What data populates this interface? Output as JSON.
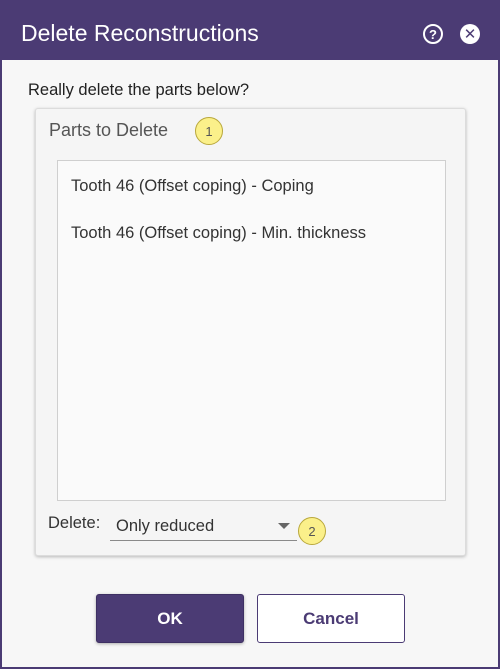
{
  "window": {
    "title": "Delete Reconstructions",
    "help_glyph": "?",
    "close_glyph": "✕"
  },
  "prompt": "Really delete the parts below?",
  "group": {
    "title": "Parts to Delete",
    "badge": "1",
    "items": [
      "Tooth 46 (Offset coping) - Coping",
      "Tooth 46 (Offset coping) - Min. thickness"
    ]
  },
  "delete_option": {
    "label": "Delete:",
    "selected": "Only reduced",
    "badge": "2"
  },
  "buttons": {
    "ok": "OK",
    "cancel": "Cancel"
  },
  "colors": {
    "accent": "#4b3b74",
    "badge": "#fbf08a"
  }
}
